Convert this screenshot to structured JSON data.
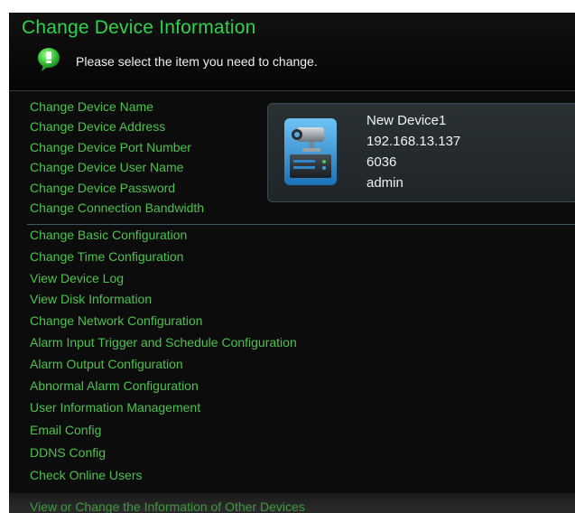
{
  "header": {
    "title": "Change Device Information",
    "hint": "Please select the item you need to change.",
    "hint_icon": "info-bubble-icon"
  },
  "menu": {
    "group1": [
      "Change Device Name",
      "Change Device Address",
      "Change Device Port Number",
      "Change Device User Name",
      "Change Device Password",
      "Change Connection Bandwidth"
    ],
    "group2": [
      "Change Basic Configuration",
      "Change Time Configuration",
      "View Device Log",
      "View Disk Information",
      "Change Network Configuration",
      "Alarm Input Trigger and Schedule Configuration",
      "Alarm Output Configuration",
      "Abnormal Alarm Configuration",
      "User Information Management",
      "Email Config",
      "DDNS Config",
      "Check Online Users"
    ]
  },
  "device": {
    "icon": "camera-dvr-icon",
    "name": "New Device1",
    "address": "192.168.13.137",
    "port": "6036",
    "user": "admin"
  },
  "footer": {
    "link": "View or Change the Information of Other Devices"
  },
  "colors": {
    "title": "#2fd34a",
    "menu_text": "#4cc34c",
    "background": "#0c0c0c"
  }
}
